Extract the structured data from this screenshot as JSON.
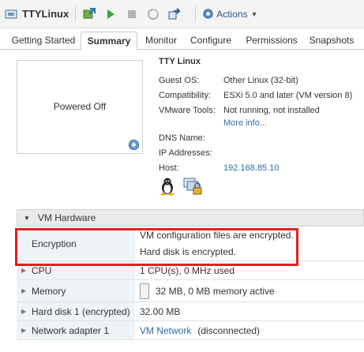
{
  "toolbar": {
    "vm_name": "TTYLinux",
    "actions_label": "Actions"
  },
  "tabs": [
    {
      "label": "Getting Started"
    },
    {
      "label": "Summary",
      "active": true
    },
    {
      "label": "Monitor"
    },
    {
      "label": "Configure"
    },
    {
      "label": "Permissions"
    },
    {
      "label": "Snapshots"
    }
  ],
  "summary": {
    "power_state": "Powered Off",
    "vm_name": "TTY Linux",
    "guest_os_label": "Guest OS:",
    "guest_os_value": "Other Linux (32-bit)",
    "compatibility_label": "Compatibility:",
    "compatibility_value": "ESXi 5.0 and later (VM version 8)",
    "vmware_tools_label": "VMware Tools:",
    "vmware_tools_value": "Not running, not installed",
    "more_info": "More info...",
    "dns_label": "DNS Name:",
    "ip_label": "IP Addresses:",
    "host_label": "Host:",
    "host_value": "192.168.85.10"
  },
  "hardware": {
    "title": "VM Hardware",
    "encryption_label": "Encryption",
    "encryption_line1": "VM configuration files are encrypted.",
    "encryption_line2": "Hard disk is encrypted.",
    "cpu_label": "CPU",
    "cpu_value": "1 CPU(s), 0 MHz used",
    "memory_label": "Memory",
    "memory_value": "32 MB, 0 MB memory active",
    "disk_label": "Hard disk 1 (encrypted)",
    "disk_value": "32.00 MB",
    "net_label": "Network adapter 1",
    "net_link": "VM Network",
    "net_status": "(disconnected)"
  },
  "colors": {
    "highlight": "#e02020",
    "link": "#2d6ea8"
  },
  "icons": [
    "vm-icon",
    "console-icon",
    "power-on-icon",
    "power-off-icon",
    "suspend-icon",
    "migrate-icon",
    "actions-gear-icon",
    "settings-gear-icon",
    "linux-penguin-icon",
    "vm-lock-icon"
  ]
}
